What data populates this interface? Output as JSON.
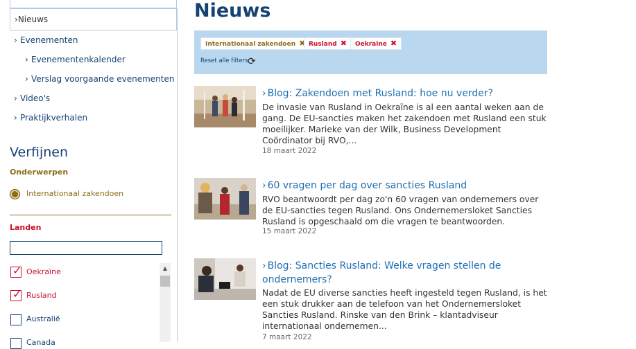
{
  "sidebar": {
    "active": "Nieuws",
    "links": [
      {
        "label": "Evenementen"
      },
      {
        "label": "Evenementenkalender"
      },
      {
        "label": "Verslag voorgaande evenementen"
      },
      {
        "label": "Video's"
      },
      {
        "label": "Praktijkverhalen"
      }
    ],
    "refine_title": "Verfijnen",
    "subjects_heading": "Onderwerpen",
    "subject_selected": "Internationaal zakendoen",
    "countries_heading": "Landen",
    "country_search_value": "",
    "countries": [
      {
        "label": "Oekraïne",
        "checked": true
      },
      {
        "label": "Rusland",
        "checked": true
      },
      {
        "label": "Australië",
        "checked": false
      },
      {
        "label": "Canada",
        "checked": false
      }
    ]
  },
  "main": {
    "title": "Nieuws",
    "filters": [
      {
        "label": "Internationaal zakendoen",
        "color": "#8b6d1a"
      },
      {
        "label": "Rusland",
        "color": "#c8102e"
      },
      {
        "label": "Oekraïne",
        "color": "#c8102e"
      }
    ],
    "reset_label": "Reset alle filters",
    "news": [
      {
        "title": "Blog: Zakendoen met Rusland: hoe nu verder?",
        "body": "De invasie van Rusland in Oekraïne is al een aantal weken aan de gang. De EU-sancties maken het zakendoen met Rusland een stuk moeilijker. Marieke van der Wilk, Business Development Coördinator bij RVO,...",
        "date": "18 maart 2022"
      },
      {
        "title": "60 vragen per dag over sancties Rusland",
        "body": "RVO beantwoordt per dag zo'n 60 vragen van ondernemers over de EU-sancties tegen Rusland. Ons Ondernemersloket Sancties Rusland is opgeschaald om die vragen te beantwoorden.",
        "date": "15 maart 2022"
      },
      {
        "title": "Blog: Sancties Rusland: Welke vragen stellen de ondernemers?",
        "body": "Nadat de EU diverse sancties heeft ingesteld tegen Rusland, is het een stuk drukker aan de telefoon van het Ondernemersloket Sancties Rusland. Rinske van den Brink – klantadviseur internationaal ondernemen...",
        "date": "7 maart 2022"
      }
    ]
  },
  "colors": {
    "brand_blue": "#154273",
    "link_blue": "#1f6fb2",
    "filter_bg": "#b9d7ee",
    "accent_red": "#c8102e",
    "accent_gold": "#8b6d1a"
  }
}
